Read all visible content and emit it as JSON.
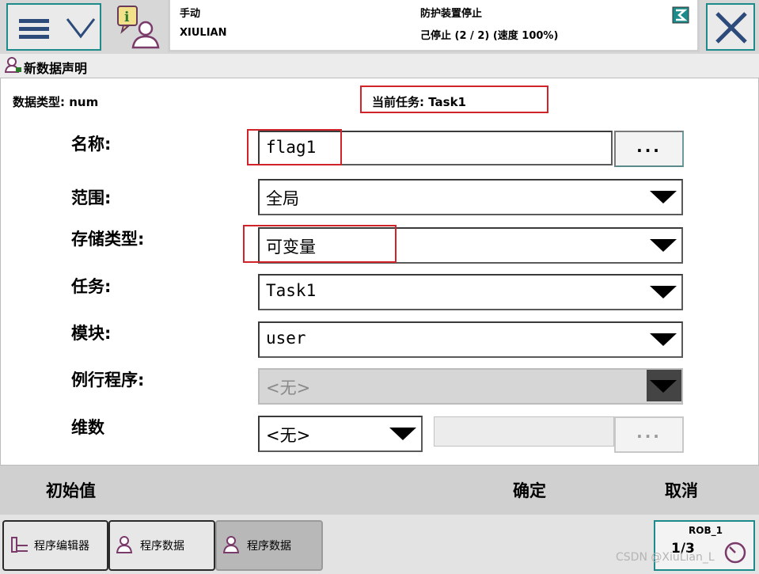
{
  "status": {
    "mode": "手动",
    "system_name": "XIULIAN",
    "safety_state": "防护装置停止",
    "run_state": "己停止 (2 / 2) (速度 100%)"
  },
  "window": {
    "title": "新数据声明"
  },
  "declaration": {
    "data_type": "数据类型: num",
    "current_task": "当前任务:   Task1",
    "fields": {
      "name": {
        "label": "名称:",
        "value": "flag1",
        "button": "..."
      },
      "scope": {
        "label": "范围:",
        "value": "全局"
      },
      "storage_type": {
        "label": "存储类型:",
        "value": "可变量"
      },
      "task": {
        "label": "任务:",
        "value": "Task1"
      },
      "module": {
        "label": "模块:",
        "value": "user"
      },
      "routine": {
        "label": "例行程序:",
        "value": "<无>"
      },
      "dimensions": {
        "label": "维数",
        "value": "<无>",
        "button": "..."
      }
    }
  },
  "commands": {
    "initial_value": "初始值",
    "ok": "确定",
    "cancel": "取消"
  },
  "taskbar": {
    "items": [
      {
        "label": "程序编辑器"
      },
      {
        "label": "程序数据"
      },
      {
        "label": "程序数据"
      }
    ],
    "robot": "ROB_1",
    "speed_fraction": "1/3"
  },
  "watermark": "CSDN @XiuLian_L",
  "colors": {
    "accent_border": "#1e8b8b",
    "highlight": "#d0232a"
  }
}
